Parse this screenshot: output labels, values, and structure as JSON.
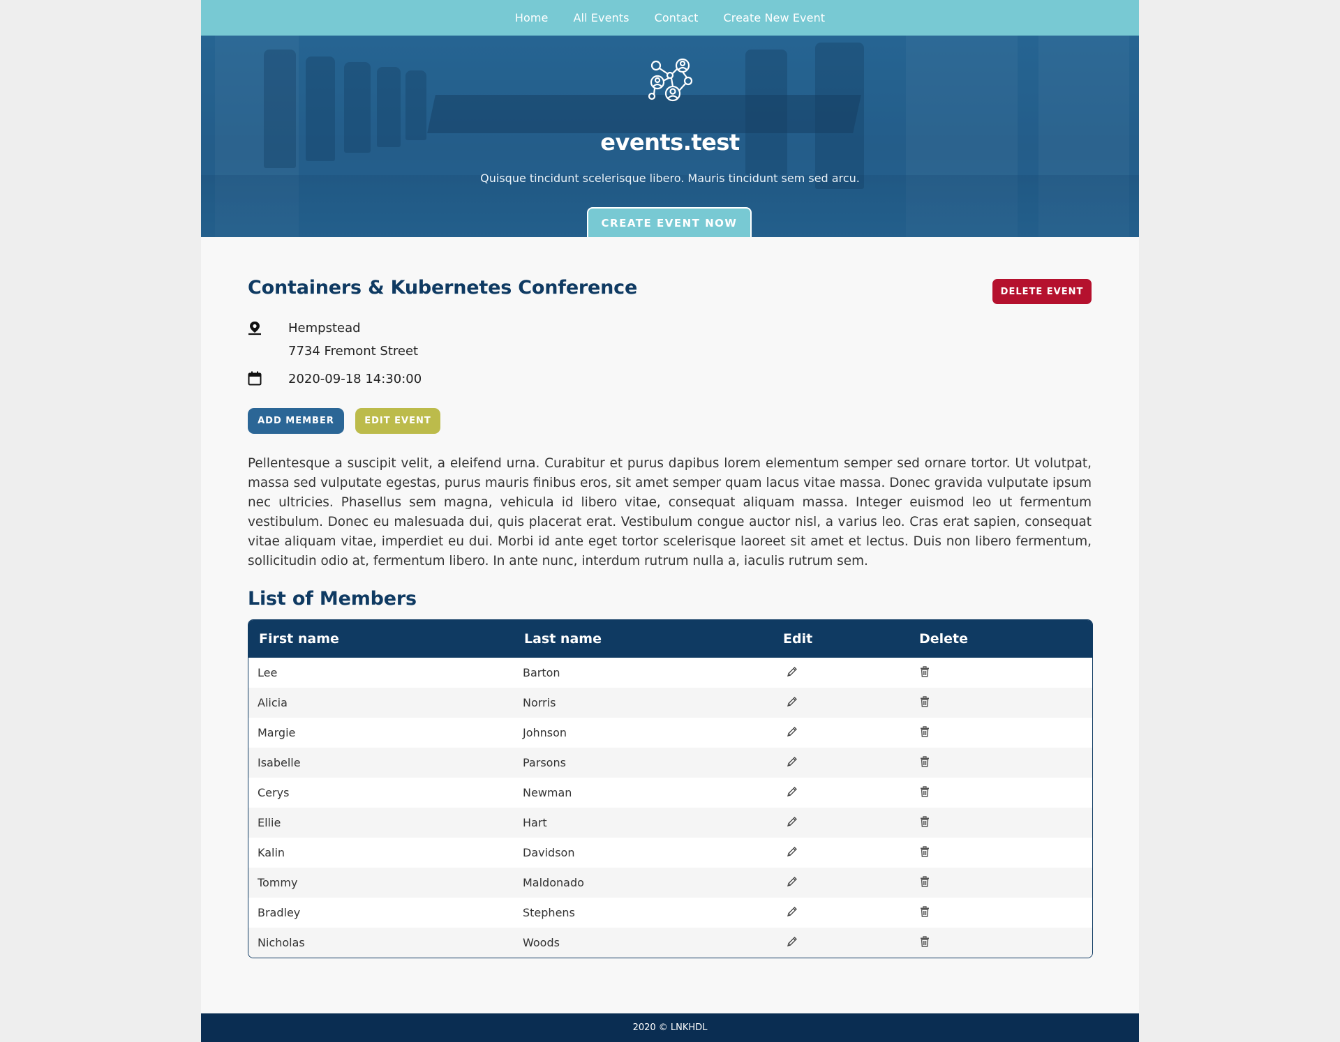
{
  "nav": {
    "items": [
      {
        "label": "Home"
      },
      {
        "label": "All Events"
      },
      {
        "label": "Contact"
      },
      {
        "label": "Create New Event"
      }
    ]
  },
  "hero": {
    "logo_icon": "network-people-icon",
    "title": "events.test",
    "subtitle": "Quisque tincidunt scelerisque libero. Mauris tincidunt sem sed arcu.",
    "cta_label": "CREATE EVENT NOW"
  },
  "event": {
    "title": "Containers & Kubernetes Conference",
    "delete_label": "DELETE EVENT",
    "location_icon": "map-pin-icon",
    "city": "Hempstead",
    "street": "7734 Fremont Street",
    "date_icon": "calendar-icon",
    "datetime": "2020-09-18 14:30:00",
    "add_member_label": "ADD MEMBER",
    "edit_event_label": "EDIT EVENT",
    "description": "Pellentesque a suscipit velit, a eleifend urna. Curabitur et purus dapibus lorem elementum semper sed ornare tortor. Ut volutpat, massa sed vulputate egestas, purus mauris finibus eros, sit amet semper quam lacus vitae massa. Donec gravida vulputate ipsum nec ultricies. Phasellus sem magna, vehicula id libero vitae, consequat aliquam massa. Integer euismod leo ut fermentum vestibulum. Donec eu malesuada dui, quis placerat erat. Vestibulum congue auctor nisl, a varius leo. Cras erat sapien, consequat vitae aliquam vitae, imperdiet eu dui. Morbi id ante eget tortor scelerisque laoreet sit amet et lectus. Duis non libero fermentum, sollicitudin odio at, fermentum libero. In ante nunc, interdum rutrum nulla a, iaculis rutrum sem."
  },
  "members": {
    "heading": "List of Members",
    "columns": {
      "first": "First name",
      "last": "Last name",
      "edit": "Edit",
      "delete": "Delete"
    },
    "edit_icon": "pencil-icon",
    "delete_icon": "trash-icon",
    "rows": [
      {
        "first": "Lee",
        "last": "Barton"
      },
      {
        "first": "Alicia",
        "last": "Norris"
      },
      {
        "first": "Margie",
        "last": "Johnson"
      },
      {
        "first": "Isabelle",
        "last": "Parsons"
      },
      {
        "first": "Cerys",
        "last": "Newman"
      },
      {
        "first": "Ellie",
        "last": "Hart"
      },
      {
        "first": "Kalin",
        "last": "Davidson"
      },
      {
        "first": "Tommy",
        "last": "Maldonado"
      },
      {
        "first": "Bradley",
        "last": "Stephens"
      },
      {
        "first": "Nicholas",
        "last": "Woods"
      }
    ]
  },
  "footer": {
    "text": "2020 © LNKHDL"
  },
  "colors": {
    "nav_bg": "#78c9d3",
    "primary_dark": "#0f3a62",
    "danger": "#b5112e",
    "add_member": "#2b6696",
    "edit_event": "#bcbb4b",
    "footer_bg": "#0a2d52"
  }
}
